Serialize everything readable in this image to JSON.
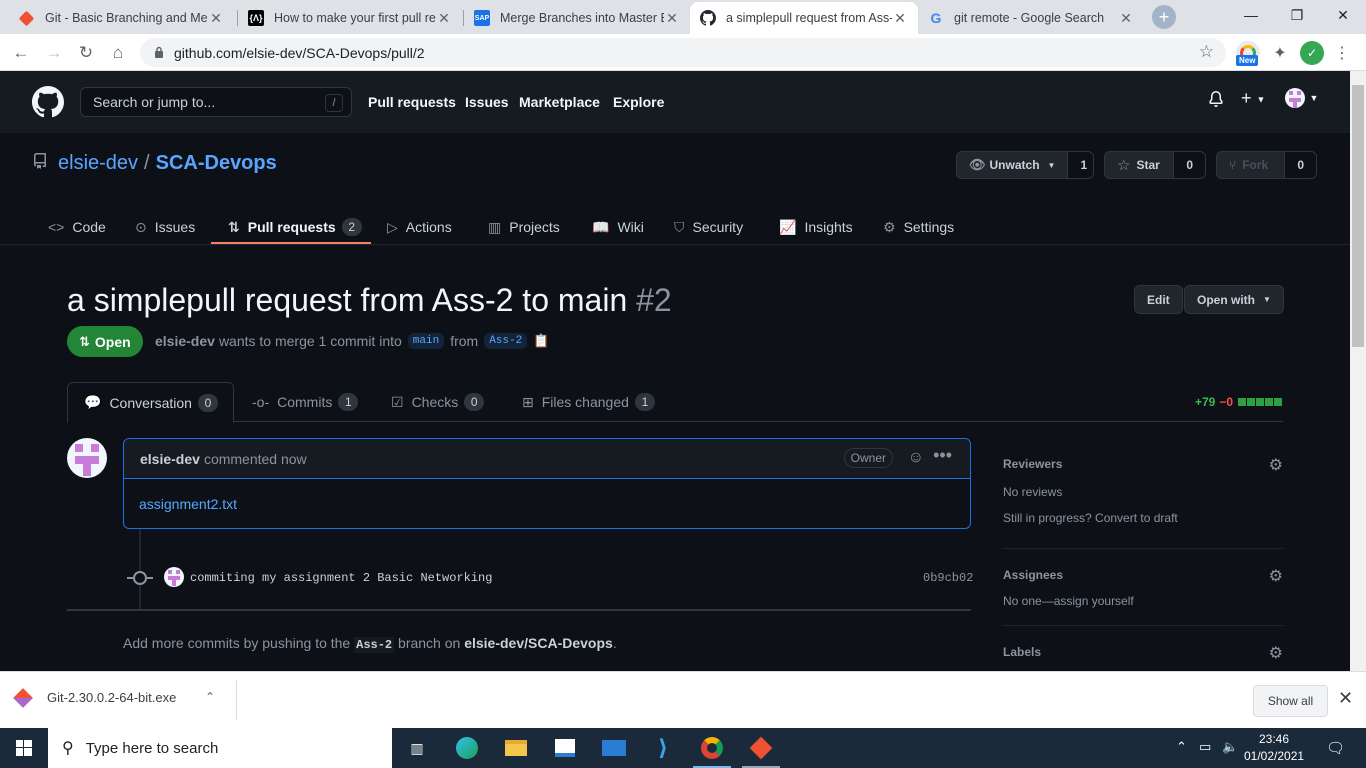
{
  "browser": {
    "tabs": [
      {
        "title": "Git - Basic Branching and Merg",
        "favicon": "git-icon",
        "active": false
      },
      {
        "title": "How to make your first pull rec",
        "favicon": "devto-icon",
        "active": false
      },
      {
        "title": "Merge Branches into Master Br",
        "favicon": "sap-icon",
        "active": false
      },
      {
        "title": "a simplepull request from Ass-",
        "favicon": "github-icon",
        "active": true
      },
      {
        "title": "git remote - Google Search",
        "favicon": "google-icon",
        "active": false
      }
    ],
    "url": "github.com/elsie-dev/SCA-Devops/pull/2",
    "new_badge": "New"
  },
  "github": {
    "search_placeholder": "Search or jump to...",
    "search_shortcut": "/",
    "nav": [
      "Pull requests",
      "Issues",
      "Marketplace",
      "Explore"
    ]
  },
  "repo": {
    "owner": "elsie-dev",
    "separator": "/",
    "name": "SCA-Devops",
    "watch_label": "Unwatch",
    "watch_count": "1",
    "star_label": "Star",
    "star_count": "0",
    "fork_label": "Fork",
    "fork_count": "0",
    "tabs": [
      {
        "label": "Code",
        "icon": "code-icon"
      },
      {
        "label": "Issues",
        "icon": "issue-icon"
      },
      {
        "label": "Pull requests",
        "icon": "pull-request-icon",
        "count": "2",
        "selected": true
      },
      {
        "label": "Actions",
        "icon": "play-icon"
      },
      {
        "label": "Projects",
        "icon": "project-icon"
      },
      {
        "label": "Wiki",
        "icon": "book-icon"
      },
      {
        "label": "Security",
        "icon": "shield-icon"
      },
      {
        "label": "Insights",
        "icon": "graph-icon"
      },
      {
        "label": "Settings",
        "icon": "gear-icon"
      }
    ]
  },
  "pr": {
    "title": "a simplepull request from Ass-2 to main",
    "number": "#2",
    "edit_label": "Edit",
    "open_with_label": "Open with",
    "state": "Open",
    "author": "elsie-dev",
    "meta_text": "wants to merge 1 commit into",
    "base_branch": "main",
    "from_text": "from",
    "head_branch": "Ass-2",
    "tabs": [
      {
        "label": "Conversation",
        "count": "0",
        "selected": true
      },
      {
        "label": "Commits",
        "count": "1"
      },
      {
        "label": "Checks",
        "count": "0"
      },
      {
        "label": "Files changed",
        "count": "1"
      }
    ],
    "additions": "+79",
    "deletions": "−0"
  },
  "comment": {
    "author": "elsie-dev",
    "action": "commented now",
    "badge": "Owner",
    "body_link": "assignment2.txt"
  },
  "commit": {
    "message": "commiting my assignment 2 Basic Networking",
    "sha": "0b9cb02"
  },
  "push_hint": {
    "prefix": "Add more commits by pushing to the",
    "branch": "Ass-2",
    "middle": "branch on",
    "repo": "elsie-dev/SCA-Devops",
    "suffix": "."
  },
  "sidebar": {
    "reviewers_title": "Reviewers",
    "reviewers_text": "No reviews",
    "draft_text": "Still in progress? Convert to draft",
    "assignees_title": "Assignees",
    "assignees_text": "No one—assign yourself",
    "labels_title": "Labels"
  },
  "download": {
    "filename": "Git-2.30.0.2-64-bit.exe",
    "show_all": "Show all"
  },
  "taskbar": {
    "search_placeholder": "Type here to search",
    "time": "23:46",
    "date": "01/02/2021"
  },
  "colors": {
    "accent_open": "#238636",
    "link": "#58a6ff",
    "tab_underline": "#f78166"
  }
}
